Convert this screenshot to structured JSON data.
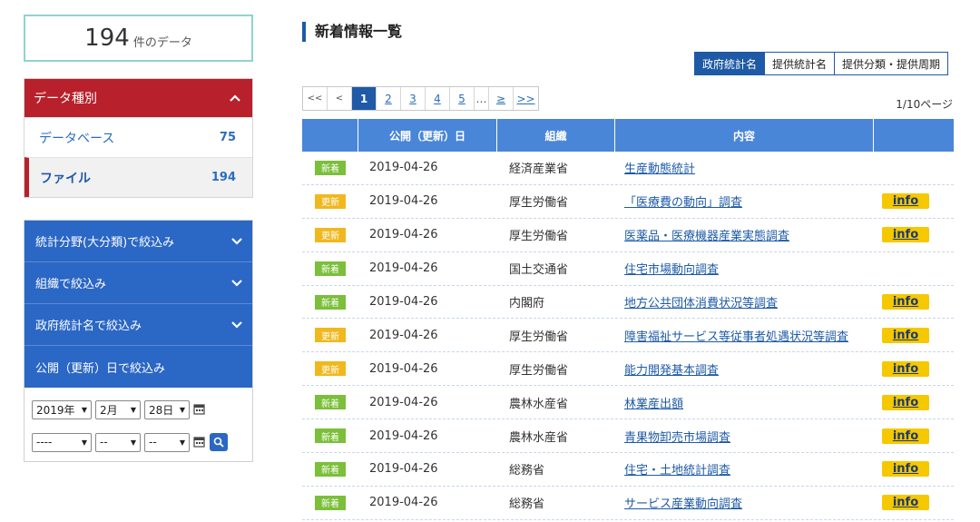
{
  "summary": {
    "count": "194",
    "unit": "件のデータ"
  },
  "data_type": {
    "header": "データ種別",
    "items": [
      {
        "label": "データベース",
        "count": "75",
        "active": false
      },
      {
        "label": "ファイル",
        "count": "194",
        "active": true
      }
    ]
  },
  "filters": {
    "items": [
      "統計分野(大分類)で絞込み",
      "組織で絞込み",
      "政府統計名で絞込み",
      "公開（更新）日で絞込み"
    ],
    "from_date": {
      "year": "2019年",
      "month": "2月",
      "day": "28日"
    },
    "to_date": {
      "year": "----",
      "month": "--",
      "day": "--"
    }
  },
  "page_title": "新着情報一覧",
  "sort_tabs": [
    "政府統計名",
    "提供統計名",
    "提供分類・提供周期"
  ],
  "pager": {
    "first": "<<",
    "prev": "<",
    "pages": [
      "1",
      "2",
      "3",
      "4",
      "5"
    ],
    "dots": "…",
    "next": "≥",
    "last": ">>",
    "current": "1",
    "info": "1/10ページ"
  },
  "table": {
    "headers": [
      "",
      "公開（更新）日",
      "組織",
      "内容",
      ""
    ],
    "rows": [
      {
        "badge": "新着",
        "type": "new",
        "date": "2019-04-26",
        "org": "経済産業省",
        "content": "生産動態統計",
        "info": ""
      },
      {
        "badge": "更新",
        "type": "upd",
        "date": "2019-04-26",
        "org": "厚生労働省",
        "content": "「医療費の動向」調査",
        "info": "info"
      },
      {
        "badge": "更新",
        "type": "upd",
        "date": "2019-04-26",
        "org": "厚生労働省",
        "content": "医薬品・医療機器産業実態調査",
        "info": "info"
      },
      {
        "badge": "新着",
        "type": "new",
        "date": "2019-04-26",
        "org": "国土交通省",
        "content": "住宅市場動向調査",
        "info": ""
      },
      {
        "badge": "新着",
        "type": "new",
        "date": "2019-04-26",
        "org": "内閣府",
        "content": "地方公共団体消費状況等調査",
        "info": "info"
      },
      {
        "badge": "更新",
        "type": "upd",
        "date": "2019-04-26",
        "org": "厚生労働省",
        "content": "障害福祉サービス等従事者処遇状況等調査",
        "info": "info"
      },
      {
        "badge": "更新",
        "type": "upd",
        "date": "2019-04-26",
        "org": "厚生労働省",
        "content": "能力開発基本調査",
        "info": "info"
      },
      {
        "badge": "新着",
        "type": "new",
        "date": "2019-04-26",
        "org": "農林水産省",
        "content": "林業産出額",
        "info": "info"
      },
      {
        "badge": "新着",
        "type": "new",
        "date": "2019-04-26",
        "org": "農林水産省",
        "content": "青果物卸売市場調査",
        "info": "info"
      },
      {
        "badge": "新着",
        "type": "new",
        "date": "2019-04-26",
        "org": "総務省",
        "content": "住宅・土地統計調査",
        "info": "info"
      },
      {
        "badge": "新着",
        "type": "new",
        "date": "2019-04-26",
        "org": "総務省",
        "content": "サービス産業動向調査",
        "info": "info"
      }
    ]
  },
  "colors": {
    "brand_blue": "#1e5aa6",
    "filter_blue": "#2b67c5",
    "red": "#b8202b",
    "new": "#7bbf3a",
    "updated": "#f0b81e",
    "info": "#f5c800"
  }
}
